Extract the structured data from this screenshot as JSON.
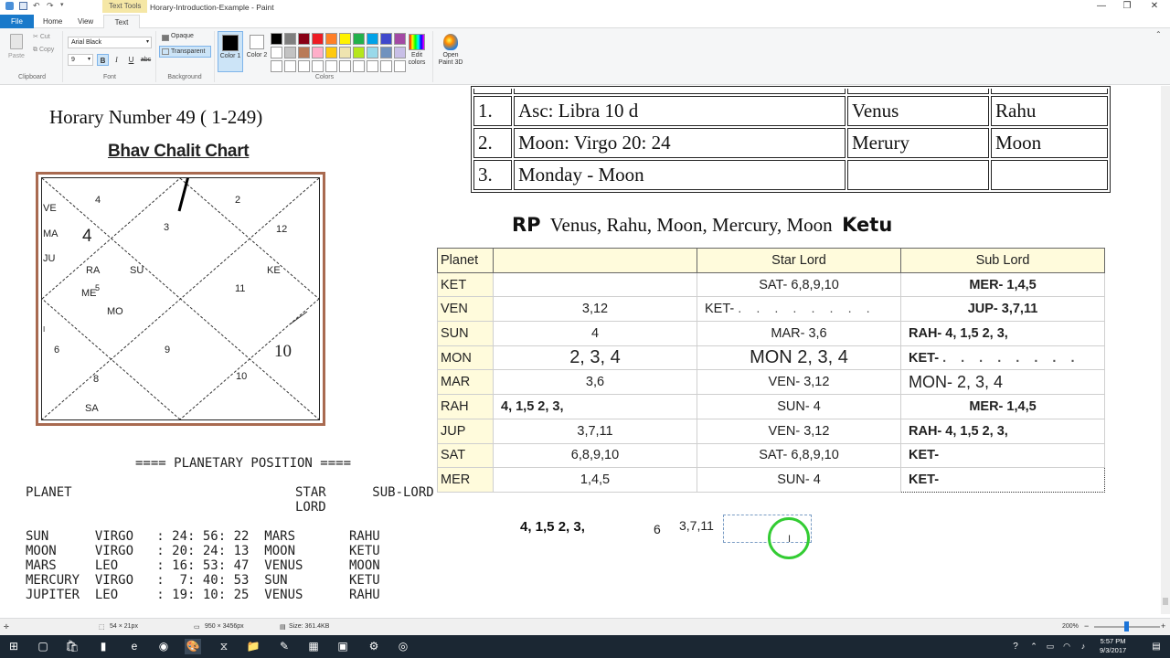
{
  "window": {
    "title": "Horary-Introduction-Example - Paint",
    "contextual_tab": "Text Tools",
    "minimize": "—",
    "maximize": "❐",
    "close": "✕"
  },
  "tabs": {
    "file": "File",
    "home": "Home",
    "view": "View",
    "text": "Text"
  },
  "ribbon": {
    "clipboard": {
      "label": "Clipboard",
      "paste": "Paste",
      "cut": "Cut",
      "copy": "Copy"
    },
    "font": {
      "label": "Font",
      "name": "Arial Black",
      "size": "9",
      "bold": "B",
      "italic": "I",
      "underline": "U",
      "strike": "abc"
    },
    "background": {
      "label": "Background",
      "opaque": "Opaque",
      "transparent": "Transparent"
    },
    "colors": {
      "label": "Colors",
      "color1": "Color 1",
      "color2": "Color 2",
      "edit_colors": "Edit colors",
      "palette": [
        "#000000",
        "#7f7f7f",
        "#880015",
        "#ed1c24",
        "#ff7f27",
        "#fff200",
        "#22b14c",
        "#00a2e8",
        "#3f48cc",
        "#a349a4",
        "#ffffff",
        "#c3c3c3",
        "#b97a57",
        "#ffaec9",
        "#ffc90e",
        "#efe4b0",
        "#b5e61d",
        "#99d9ea",
        "#7092be",
        "#c8bfe7",
        "#ffffff",
        "#ffffff",
        "#ffffff",
        "#ffffff",
        "#ffffff",
        "#ffffff",
        "#ffffff",
        "#ffffff",
        "#ffffff",
        "#ffffff"
      ]
    },
    "paint3d": "Open Paint 3D"
  },
  "canvas": {
    "horary_title": "Horary Number 49 ( 1-249)",
    "chart_heading": "Bhav Chalit Chart",
    "chart_labels": [
      {
        "id": "h4a",
        "text": "4"
      },
      {
        "id": "h2",
        "text": "2"
      },
      {
        "id": "h3",
        "text": "3"
      },
      {
        "id": "h12",
        "text": "12"
      },
      {
        "id": "ve",
        "text": "VE"
      },
      {
        "id": "ma",
        "text": "MA"
      },
      {
        "id": "h4big",
        "text": "4"
      },
      {
        "id": "ju",
        "text": "JU"
      },
      {
        "id": "ra",
        "text": "RA"
      },
      {
        "id": "su",
        "text": "SU"
      },
      {
        "id": "ke",
        "text": "KE"
      },
      {
        "id": "me",
        "text": "ME"
      },
      {
        "id": "me5",
        "text": "5"
      },
      {
        "id": "h11",
        "text": "11"
      },
      {
        "id": "mo",
        "text": "MO"
      },
      {
        "id": "tick",
        "text": "I"
      },
      {
        "id": "h6",
        "text": "6"
      },
      {
        "id": "h9",
        "text": "9"
      },
      {
        "id": "h10big",
        "text": "10"
      },
      {
        "id": "h8",
        "text": "8"
      },
      {
        "id": "h10",
        "text": "10"
      },
      {
        "id": "sa",
        "text": "SA"
      }
    ],
    "top_table": [
      [
        "1.",
        "Asc: Libra 10 d",
        "Venus",
        "Rahu"
      ],
      [
        "2.",
        "Moon: Virgo 20: 24",
        "Merury",
        "Moon"
      ],
      [
        "3.",
        "Monday - Moon",
        "",
        ""
      ]
    ],
    "rp": {
      "label": "RP",
      "text": "Venus, Rahu, Moon, Mercury, Moon",
      "ketu": "Ketu"
    },
    "planet_table": {
      "headers": [
        "Planet",
        "",
        "Star Lord",
        "Sub Lord"
      ],
      "rows": [
        {
          "planet": "KET",
          "col1": "",
          "star": "SAT- 6,8,9,10",
          "sub": "MER- 1,4,5"
        },
        {
          "planet": "VEN",
          "col1": "3,12",
          "star": "KET-",
          "sub": "JUP- 3,7,11"
        },
        {
          "planet": "SUN",
          "col1": "4",
          "star": "MAR- 3,6",
          "sub": "RAH- 4, 1,5 2, 3,"
        },
        {
          "planet": "MON",
          "col1": "2, 3, 4",
          "star": "MON 2, 3, 4",
          "sub": "KET-"
        },
        {
          "planet": "MAR",
          "col1": "3,6",
          "star": "VEN- 3,12",
          "sub": "MON- 2, 3, 4"
        },
        {
          "planet": "RAH",
          "col1": "4, 1,5 2, 3,",
          "star": "SUN- 4",
          "sub": "MER- 1,4,5"
        },
        {
          "planet": "JUP",
          "col1": "3,7,11",
          "star": "VEN- 3,12",
          "sub": "RAH- 4, 1,5 2, 3,"
        },
        {
          "planet": "SAT",
          "col1": "6,8,9,10",
          "star": "SAT- 6,8,9,10",
          "sub": "KET-"
        },
        {
          "planet": "MER",
          "col1": "1,4,5",
          "star": "SUN- 4",
          "sub": "KET-"
        }
      ],
      "dots": ". . . . . . . ."
    },
    "planetary_position": {
      "title": "==== PLANETARY POSITION ====",
      "header": "PLANET                             STAR      SUB-LORD\n                                   LORD",
      "rows": "SUN      VIRGO   : 24: 56: 22  MARS       RAHU\nMOON     VIRGO   : 20: 24: 13  MOON       KETU\nMARS     LEO     : 16: 53: 47  VENUS      MOON\nMERCURY  VIRGO   :  7: 40: 53  SUN        KETU\nJUPITER  LEO     : 19: 10: 25  VENUS      RAHU"
    },
    "bottom": {
      "bold_text": "4,  1,5   2, 3,",
      "six": "6",
      "ruled": "3,7,11",
      "cursor": "I"
    }
  },
  "status": {
    "cursor_pos": "",
    "selection": "54 × 21px",
    "image_size": "950 × 3456px",
    "file_size": "Size: 361.4KB",
    "zoom": "200%",
    "zoom_minus": "−",
    "zoom_plus": "+"
  },
  "taskbar": {
    "time": "5:57 PM",
    "date": "9/3/2017"
  }
}
